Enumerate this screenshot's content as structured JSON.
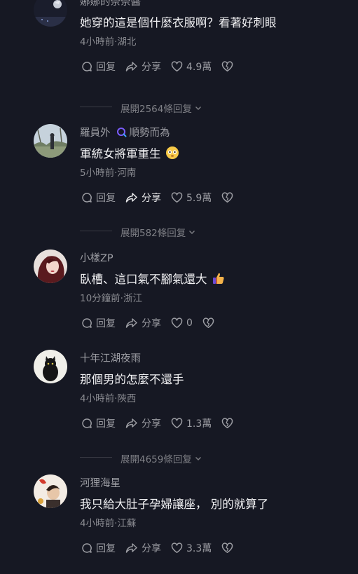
{
  "labels": {
    "reply": "回复",
    "share": "分享"
  },
  "comments": [
    {
      "username": "娜娜的奈奈醬",
      "text": "她穿的這是個什麼衣服啊？看著好刺眼",
      "meta": "4小時前·湖北",
      "likes": "4.9萬",
      "avatar_icon": "avatar-dark-night"
    },
    {
      "username": "羅員外",
      "tag": "順勢而為",
      "text": "軍統女將軍重生",
      "emoji": "flushed-face-emoji",
      "meta": "5小時前·河南",
      "likes": "5.9萬",
      "avatar_icon": "avatar-person-outdoors"
    },
    {
      "username": "小樣ZP",
      "text": "臥槽、這口氣不腳氣還大",
      "emoji": "thumbs-up-emoji",
      "meta": "10分鐘前·浙江",
      "likes": "0",
      "avatar_icon": "avatar-woman-red"
    },
    {
      "username": "十年江湖夜雨",
      "text": "那個男的怎麼不還手",
      "meta": "4小時前·陝西",
      "likes": "1.3萬",
      "avatar_icon": "avatar-black-cat"
    },
    {
      "username": "河狸海星",
      "text": "我只給大肚子孕婦讓座， 別的就算了",
      "meta": "4小時前·江蘇",
      "likes": "3.3萬",
      "avatar_icon": "avatar-character-red"
    }
  ],
  "expanders": [
    {
      "label": "展開2564條回复"
    },
    {
      "label": "展開582條回复"
    },
    {
      "label": "展開4659條回复"
    }
  ],
  "colors": {
    "background": "#161823",
    "primary_text": "#f1f1f3",
    "secondary_text": "#9c9da3",
    "tag_accent": "#7b5cff"
  }
}
